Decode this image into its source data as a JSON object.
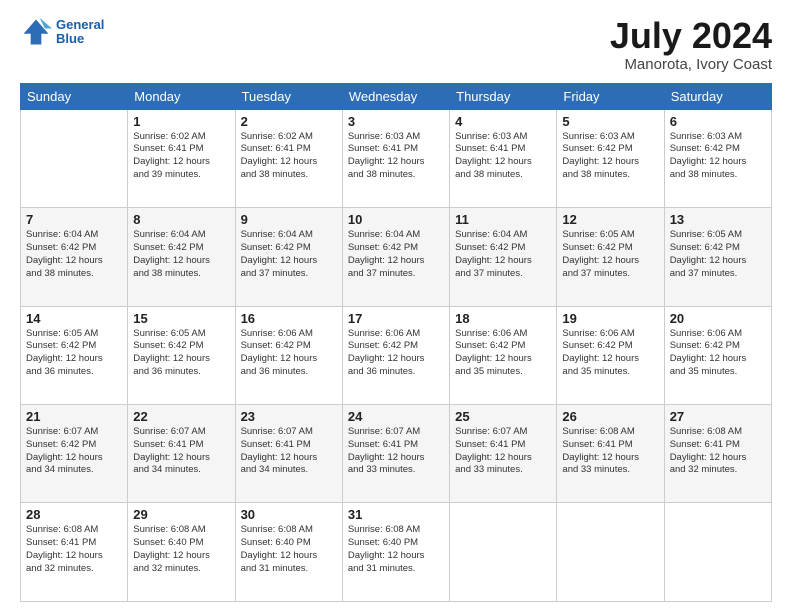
{
  "header": {
    "logo_line1": "General",
    "logo_line2": "Blue",
    "title": "July 2024",
    "location": "Manorota, Ivory Coast"
  },
  "days_of_week": [
    "Sunday",
    "Monday",
    "Tuesday",
    "Wednesday",
    "Thursday",
    "Friday",
    "Saturday"
  ],
  "weeks": [
    [
      {
        "day": "",
        "info": ""
      },
      {
        "day": "1",
        "info": "Sunrise: 6:02 AM\nSunset: 6:41 PM\nDaylight: 12 hours\nand 39 minutes."
      },
      {
        "day": "2",
        "info": "Sunrise: 6:02 AM\nSunset: 6:41 PM\nDaylight: 12 hours\nand 38 minutes."
      },
      {
        "day": "3",
        "info": "Sunrise: 6:03 AM\nSunset: 6:41 PM\nDaylight: 12 hours\nand 38 minutes."
      },
      {
        "day": "4",
        "info": "Sunrise: 6:03 AM\nSunset: 6:41 PM\nDaylight: 12 hours\nand 38 minutes."
      },
      {
        "day": "5",
        "info": "Sunrise: 6:03 AM\nSunset: 6:42 PM\nDaylight: 12 hours\nand 38 minutes."
      },
      {
        "day": "6",
        "info": "Sunrise: 6:03 AM\nSunset: 6:42 PM\nDaylight: 12 hours\nand 38 minutes."
      }
    ],
    [
      {
        "day": "7",
        "info": "Sunrise: 6:04 AM\nSunset: 6:42 PM\nDaylight: 12 hours\nand 38 minutes."
      },
      {
        "day": "8",
        "info": "Sunrise: 6:04 AM\nSunset: 6:42 PM\nDaylight: 12 hours\nand 38 minutes."
      },
      {
        "day": "9",
        "info": "Sunrise: 6:04 AM\nSunset: 6:42 PM\nDaylight: 12 hours\nand 37 minutes."
      },
      {
        "day": "10",
        "info": "Sunrise: 6:04 AM\nSunset: 6:42 PM\nDaylight: 12 hours\nand 37 minutes."
      },
      {
        "day": "11",
        "info": "Sunrise: 6:04 AM\nSunset: 6:42 PM\nDaylight: 12 hours\nand 37 minutes."
      },
      {
        "day": "12",
        "info": "Sunrise: 6:05 AM\nSunset: 6:42 PM\nDaylight: 12 hours\nand 37 minutes."
      },
      {
        "day": "13",
        "info": "Sunrise: 6:05 AM\nSunset: 6:42 PM\nDaylight: 12 hours\nand 37 minutes."
      }
    ],
    [
      {
        "day": "14",
        "info": "Sunrise: 6:05 AM\nSunset: 6:42 PM\nDaylight: 12 hours\nand 36 minutes."
      },
      {
        "day": "15",
        "info": "Sunrise: 6:05 AM\nSunset: 6:42 PM\nDaylight: 12 hours\nand 36 minutes."
      },
      {
        "day": "16",
        "info": "Sunrise: 6:06 AM\nSunset: 6:42 PM\nDaylight: 12 hours\nand 36 minutes."
      },
      {
        "day": "17",
        "info": "Sunrise: 6:06 AM\nSunset: 6:42 PM\nDaylight: 12 hours\nand 36 minutes."
      },
      {
        "day": "18",
        "info": "Sunrise: 6:06 AM\nSunset: 6:42 PM\nDaylight: 12 hours\nand 35 minutes."
      },
      {
        "day": "19",
        "info": "Sunrise: 6:06 AM\nSunset: 6:42 PM\nDaylight: 12 hours\nand 35 minutes."
      },
      {
        "day": "20",
        "info": "Sunrise: 6:06 AM\nSunset: 6:42 PM\nDaylight: 12 hours\nand 35 minutes."
      }
    ],
    [
      {
        "day": "21",
        "info": "Sunrise: 6:07 AM\nSunset: 6:42 PM\nDaylight: 12 hours\nand 34 minutes."
      },
      {
        "day": "22",
        "info": "Sunrise: 6:07 AM\nSunset: 6:41 PM\nDaylight: 12 hours\nand 34 minutes."
      },
      {
        "day": "23",
        "info": "Sunrise: 6:07 AM\nSunset: 6:41 PM\nDaylight: 12 hours\nand 34 minutes."
      },
      {
        "day": "24",
        "info": "Sunrise: 6:07 AM\nSunset: 6:41 PM\nDaylight: 12 hours\nand 33 minutes."
      },
      {
        "day": "25",
        "info": "Sunrise: 6:07 AM\nSunset: 6:41 PM\nDaylight: 12 hours\nand 33 minutes."
      },
      {
        "day": "26",
        "info": "Sunrise: 6:08 AM\nSunset: 6:41 PM\nDaylight: 12 hours\nand 33 minutes."
      },
      {
        "day": "27",
        "info": "Sunrise: 6:08 AM\nSunset: 6:41 PM\nDaylight: 12 hours\nand 32 minutes."
      }
    ],
    [
      {
        "day": "28",
        "info": "Sunrise: 6:08 AM\nSunset: 6:41 PM\nDaylight: 12 hours\nand 32 minutes."
      },
      {
        "day": "29",
        "info": "Sunrise: 6:08 AM\nSunset: 6:40 PM\nDaylight: 12 hours\nand 32 minutes."
      },
      {
        "day": "30",
        "info": "Sunrise: 6:08 AM\nSunset: 6:40 PM\nDaylight: 12 hours\nand 31 minutes."
      },
      {
        "day": "31",
        "info": "Sunrise: 6:08 AM\nSunset: 6:40 PM\nDaylight: 12 hours\nand 31 minutes."
      },
      {
        "day": "",
        "info": ""
      },
      {
        "day": "",
        "info": ""
      },
      {
        "day": "",
        "info": ""
      }
    ]
  ]
}
